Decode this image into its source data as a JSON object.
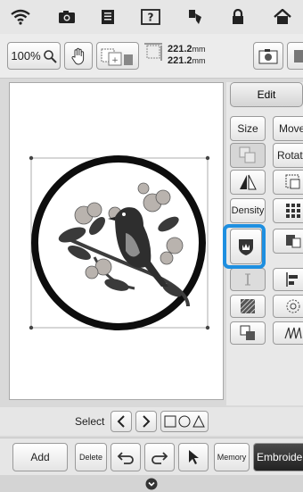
{
  "statusbar": {
    "icons": [
      "wifi-icon",
      "camera-icon",
      "document-icon",
      "help-icon",
      "thread-icon",
      "lock-icon",
      "home-icon"
    ]
  },
  "toolbar": {
    "zoom_label": "100%",
    "width_value": "221.2",
    "height_value": "221.2",
    "unit": "mm"
  },
  "panel": {
    "edit_label": "Edit",
    "size_label": "Size",
    "move_label": "Move",
    "rotate_label": "Rotate",
    "density_label": "Density"
  },
  "select": {
    "label": "Select"
  },
  "bottombar": {
    "add_label": "Add",
    "delete_label": "Delete",
    "memory_label": "Memory",
    "embroidery_label": "Embroidery"
  }
}
